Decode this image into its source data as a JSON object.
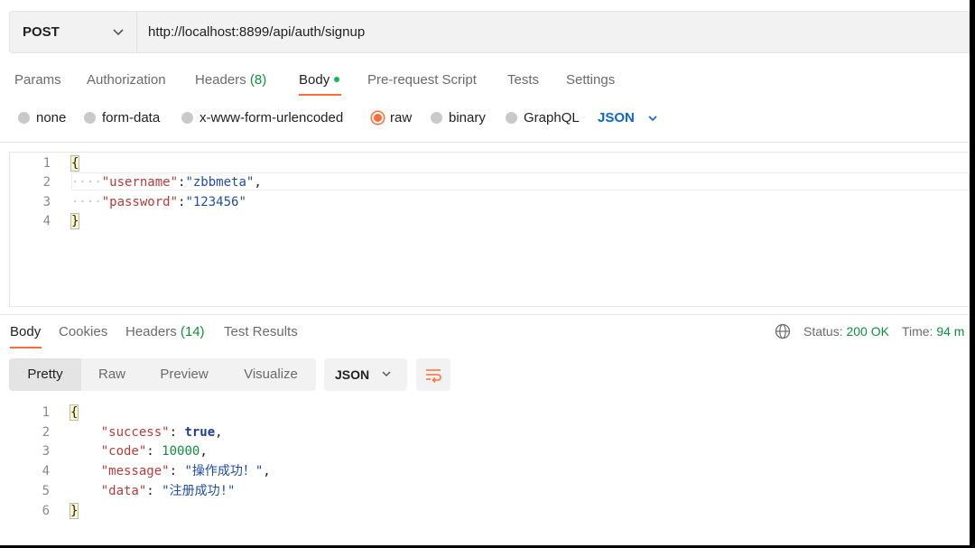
{
  "request": {
    "method": "POST",
    "url": "http://localhost:8899/api/auth/signup"
  },
  "request_tabs": [
    {
      "label": "Params"
    },
    {
      "label": "Authorization"
    },
    {
      "label": "Headers",
      "count": "(8)"
    },
    {
      "label": "Body",
      "active": true
    },
    {
      "label": "Pre-request Script"
    },
    {
      "label": "Tests"
    },
    {
      "label": "Settings"
    }
  ],
  "body_types": [
    "none",
    "form-data",
    "x-www-form-urlencoded",
    "raw",
    "binary",
    "GraphQL"
  ],
  "body_type_selected": "raw",
  "raw_format": "JSON",
  "request_body": {
    "line_numbers": [
      "1",
      "2",
      "3",
      "4"
    ],
    "open_brace": "{",
    "key1": "\"username\"",
    "val1": "\"zbbmeta\"",
    "key2": "\"password\"",
    "val2": "\"123456\"",
    "close_brace": "}"
  },
  "response_tabs": [
    {
      "label": "Body",
      "active": true
    },
    {
      "label": "Cookies"
    },
    {
      "label": "Headers",
      "count": "(14)"
    },
    {
      "label": "Test Results"
    }
  ],
  "status": {
    "status_label": "Status:",
    "status_value": "200 OK",
    "time_label": "Time:",
    "time_value": "94 m"
  },
  "view_modes": [
    "Pretty",
    "Raw",
    "Preview",
    "Visualize"
  ],
  "response_format": "JSON",
  "response_body": {
    "line_numbers": [
      "1",
      "2",
      "3",
      "4",
      "5",
      "6"
    ],
    "open_brace": "{",
    "k_success": "\"success\"",
    "v_success": "true",
    "k_code": "\"code\"",
    "v_code": "10000",
    "k_message": "\"message\"",
    "v_message": "\"操作成功！\"",
    "k_data": "\"data\"",
    "v_data": "\"注册成功!\"",
    "close_brace": "}"
  },
  "colors": {
    "accent": "#ff6c37",
    "success": "#0f8f3e",
    "link": "#0d65d9"
  },
  "icons": [
    "chevron-down-icon",
    "globe-icon",
    "wrap-lines-icon"
  ]
}
